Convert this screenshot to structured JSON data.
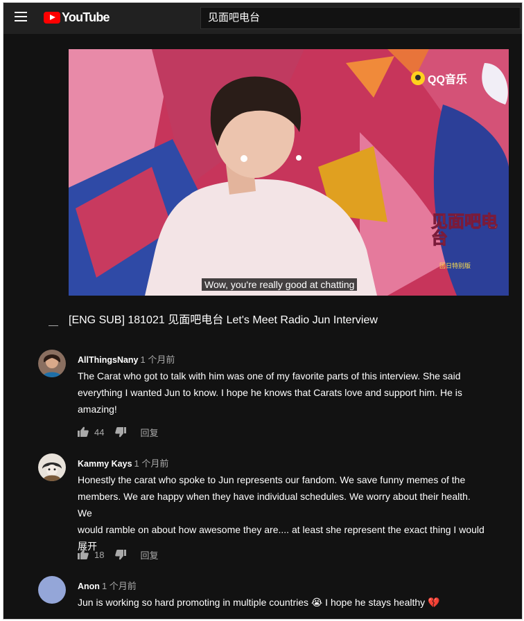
{
  "header": {
    "logo_text": "YouTube",
    "search_value": "见面吧电台"
  },
  "video": {
    "subtitle": "Wow, you're really good at chatting",
    "watermark": "QQ音乐",
    "show_logo_text": "见面吧电台",
    "show_logo_subtext": "团日特别版",
    "title": "[ENG SUB] 181021 见面吧电台 Let's Meet Radio Jun Interview"
  },
  "comments": [
    {
      "author": "AllThingsNany",
      "time": "1 个月前",
      "lines": [
        "The Carat who got to talk with him was one of my favorite parts of this interview. She said",
        "everything I wanted Jun to know. I hope he knows that Carats love and support him. He is",
        "amazing!"
      ],
      "likes": "44",
      "reply_label": "回复"
    },
    {
      "author": "Kammy Kays",
      "time": "1 个月前",
      "lines": [
        "Honestly the carat who spoke to Jun represents our fandom. We save funny memes of the",
        "members. We are happy when they have individual schedules. We worry about their health. We",
        "would ramble on about how awesome they are.... at least she represent the exact thing I would"
      ],
      "expand_label": "展开",
      "likes": "18",
      "reply_label": "回复"
    },
    {
      "author": "Anon",
      "time": "1 个月前",
      "lines": [
        "Jun is working so hard promoting in multiple countries 😭 I hope he stays healthy 💔"
      ]
    }
  ],
  "colors": {
    "background": "#121212",
    "topbar": "#212121",
    "brand_red": "#ff0000",
    "text_primary": "#ffffff",
    "text_secondary": "#aaaaaa"
  }
}
